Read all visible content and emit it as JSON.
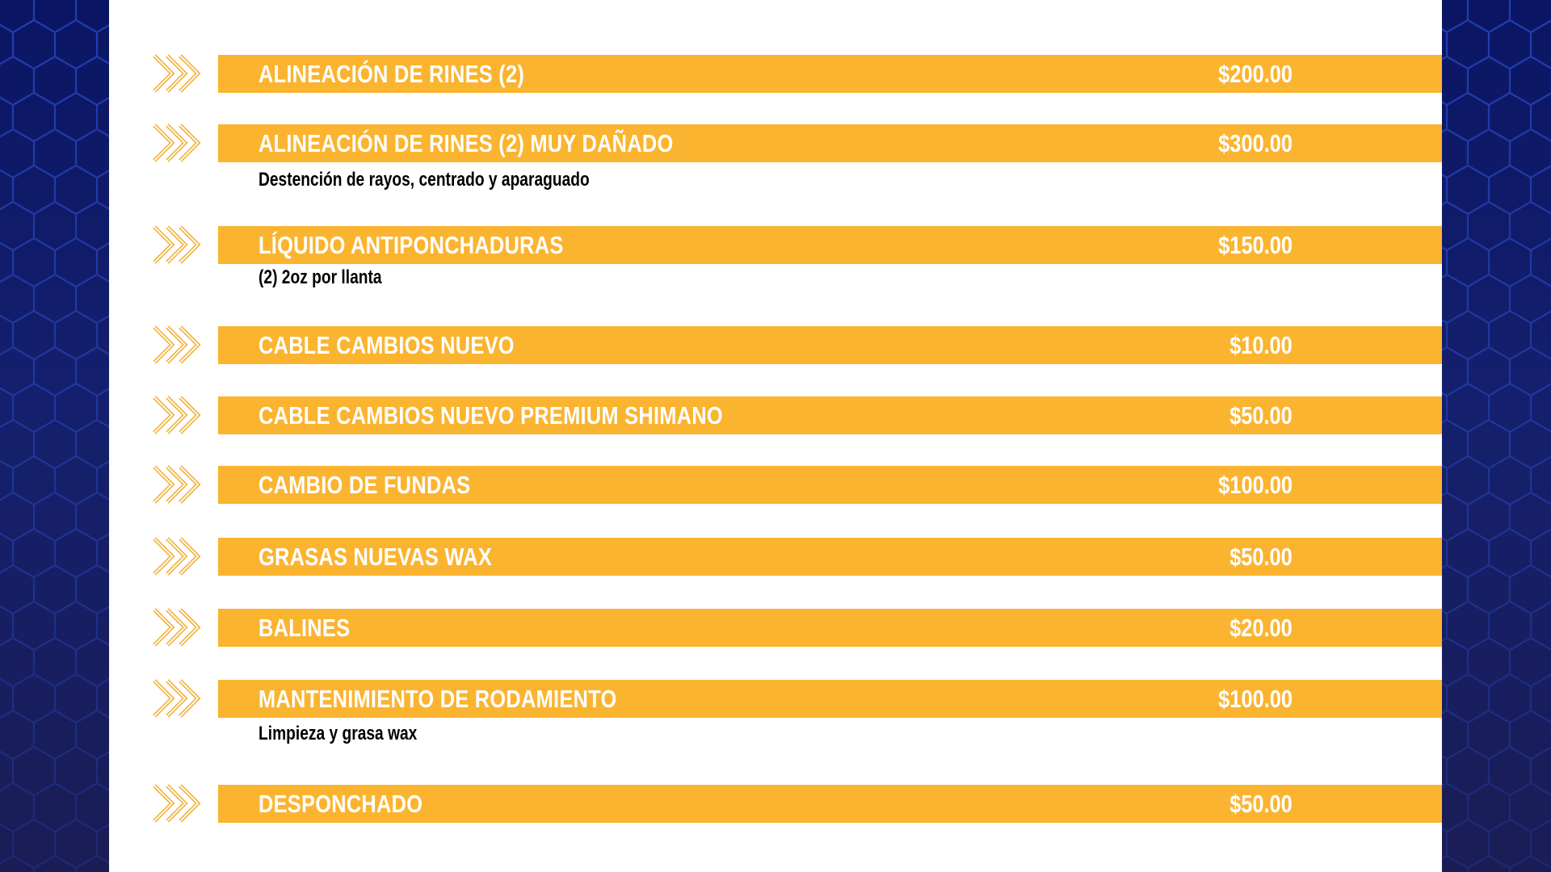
{
  "colors": {
    "bar": "#fbb430",
    "chevron": "#f2b440",
    "side_panel": "#14206e",
    "hexagon_lines": "#2a4cc8"
  },
  "icons": {
    "row_marker": "triple-chevron-right-icon",
    "side_pattern": "hexagon-pattern"
  },
  "items": [
    {
      "name": "ALINEACIÓN DE RINES (2)",
      "price": "$200.00",
      "description": ""
    },
    {
      "name": "ALINEACIÓN DE RINES (2) MUY DAÑADO",
      "price": "$300.00",
      "description": "Destención de rayos, centrado y aparaguado"
    },
    {
      "name": "LÍQUIDO ANTIPONCHADURAS",
      "price": "$150.00",
      "description": "(2) 2oz por llanta"
    },
    {
      "name": "CABLE CAMBIOS NUEVO",
      "price": "$10.00",
      "description": ""
    },
    {
      "name": "CABLE CAMBIOS NUEVO PREMIUM SHIMANO",
      "price": "$50.00",
      "description": ""
    },
    {
      "name": "CAMBIO DE FUNDAS",
      "price": "$100.00",
      "description": ""
    },
    {
      "name": "GRASAS NUEVAS WAX",
      "price": "$50.00",
      "description": ""
    },
    {
      "name": "BALINES",
      "price": "$20.00",
      "description": ""
    },
    {
      "name": "MANTENIMIENTO DE RODAMIENTO",
      "price": "$100.00",
      "description": "Limpieza y grasa wax"
    },
    {
      "name": "DESPONCHADO",
      "price": "$50.00",
      "description": ""
    }
  ]
}
